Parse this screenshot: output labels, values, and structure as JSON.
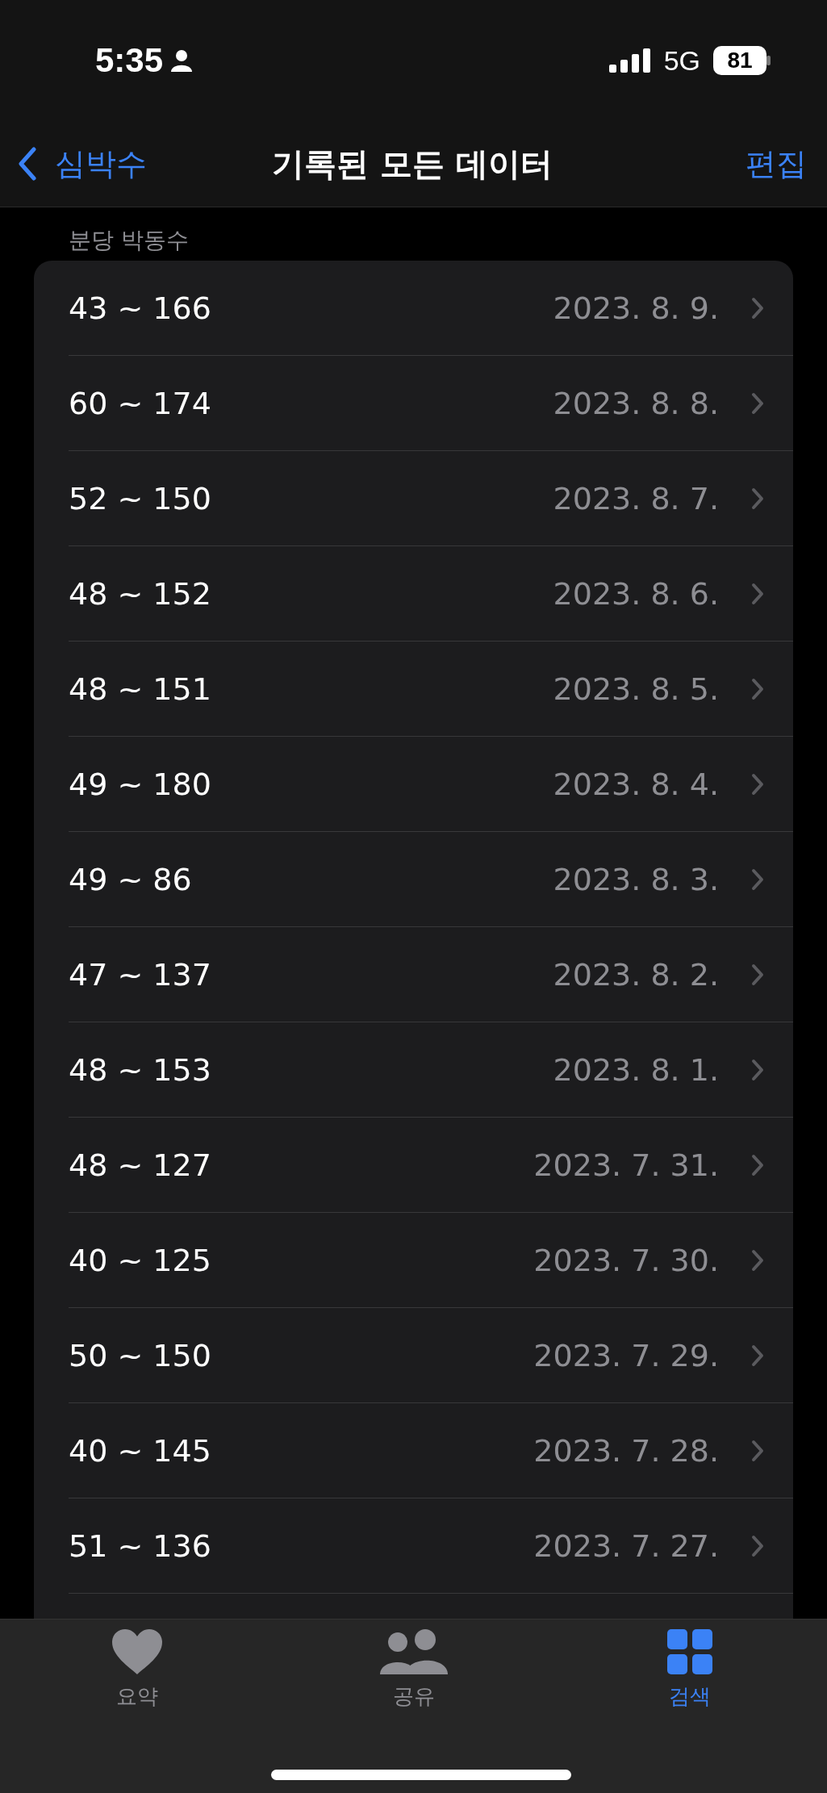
{
  "status_bar": {
    "time": "5:35",
    "network": "5G",
    "battery": "81"
  },
  "nav_bar": {
    "back": "심박수",
    "title": "기록된 모든 데이터",
    "action": "편집"
  },
  "section": {
    "header": "분당 박동수",
    "rows": [
      {
        "value": "43 ~ 166",
        "date": "2023. 8. 9."
      },
      {
        "value": "60 ~ 174",
        "date": "2023. 8. 8."
      },
      {
        "value": "52 ~ 150",
        "date": "2023. 8. 7."
      },
      {
        "value": "48 ~ 152",
        "date": "2023. 8. 6."
      },
      {
        "value": "48 ~ 151",
        "date": "2023. 8. 5."
      },
      {
        "value": "49 ~ 180",
        "date": "2023. 8. 4."
      },
      {
        "value": "49 ~ 86",
        "date": "2023. 8. 3."
      },
      {
        "value": "47 ~ 137",
        "date": "2023. 8. 2."
      },
      {
        "value": "48 ~ 153",
        "date": "2023. 8. 1."
      },
      {
        "value": "48 ~ 127",
        "date": "2023. 7. 31."
      },
      {
        "value": "40 ~ 125",
        "date": "2023. 7. 30."
      },
      {
        "value": "50 ~ 150",
        "date": "2023. 7. 29."
      },
      {
        "value": "40 ~ 145",
        "date": "2023. 7. 28."
      },
      {
        "value": "51 ~ 136",
        "date": "2023. 7. 27."
      }
    ]
  },
  "tabs": [
    {
      "label": "요약",
      "kind": "heart",
      "selected": false
    },
    {
      "label": "공유",
      "kind": "people",
      "selected": false
    },
    {
      "label": "검색",
      "kind": "grid",
      "selected": true
    }
  ]
}
